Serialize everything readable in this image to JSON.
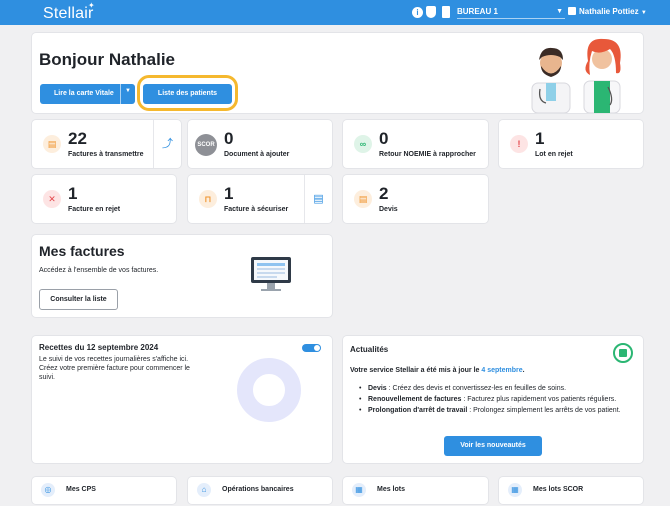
{
  "app": {
    "logo": "Stellair"
  },
  "topbar": {
    "bureau": "BUREAU 1",
    "user": "Nathalie Pottiez"
  },
  "greeting": {
    "title": "Bonjour Nathalie",
    "btn_vitale": "Lire la carte Vitale",
    "btn_patients": "Liste des patients"
  },
  "stats": [
    {
      "value": "22",
      "label": "Factures à transmettre"
    },
    {
      "value": "0",
      "label": "Document à ajouter",
      "icon_text": "SCOR"
    },
    {
      "value": "0",
      "label": "Retour NOEMIE à rapprocher"
    },
    {
      "value": "1",
      "label": "Lot en rejet"
    },
    {
      "value": "1",
      "label": "Facture en rejet"
    },
    {
      "value": "1",
      "label": "Facture à sécuriser"
    },
    {
      "value": "2",
      "label": "Devis"
    }
  ],
  "factures": {
    "title": "Mes factures",
    "desc": "Accédez à l'ensemble de vos factures.",
    "button": "Consulter la liste"
  },
  "recettes": {
    "title": "Recettes du 12 septembre 2024",
    "desc": "Le suivi de vos recettes journalières s'affiche ici. Créez votre première facture pour commencer le suivi.",
    "toggle_on": true
  },
  "actualites": {
    "title": "Actualités",
    "intro_a": "Votre service Stellair a été mis à jour le ",
    "intro_date": "4 septembre",
    "intro_b": ".",
    "items": [
      {
        "label": "Devis",
        "text": " : Créez des devis et convertissez-les en feuilles de soins."
      },
      {
        "label": "Renouvellement de factures",
        "text": " : Facturez plus rapidement vos patients réguliers."
      },
      {
        "label": "Prolongation d'arrêt de travail",
        "text": " : Prolongez simplement les arrêts de vos patient."
      }
    ],
    "button": "Voir les nouveautés"
  },
  "bottom": [
    {
      "label": "Mes CPS"
    },
    {
      "label": "Opérations bancaires"
    },
    {
      "label": "Mes lots"
    },
    {
      "label": "Mes lots SCOR"
    }
  ],
  "colors": {
    "primary": "#2f8fe0",
    "highlight": "#f5b82e",
    "accent_green": "#2bb673"
  }
}
